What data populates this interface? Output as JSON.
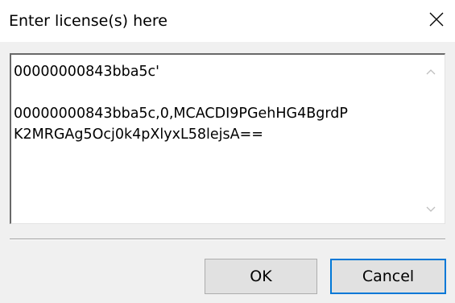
{
  "window": {
    "title": "Enter license(s) here",
    "close_icon": "close-icon"
  },
  "license_text": {
    "content": "00000000843bba5c'\n\n00000000843bba5c,0,MCACDI9PGehHG4BgrdP\nK2MRGAg5Ocj0k4pXlyxL58lejsA=="
  },
  "scrollbar": {
    "up_icon": "scroll-up-arrow-icon",
    "down_icon": "scroll-down-arrow-icon"
  },
  "buttons": {
    "ok_label": "OK",
    "cancel_label": "Cancel"
  }
}
